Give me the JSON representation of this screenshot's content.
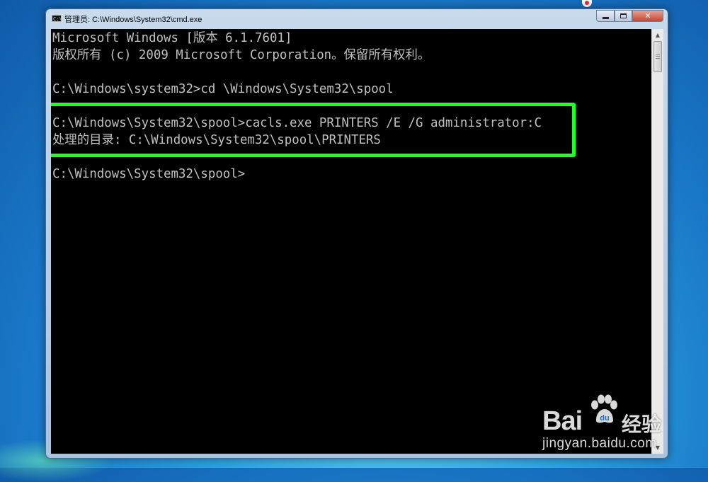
{
  "window": {
    "title": "管理员: C:\\Windows\\System32\\cmd.exe",
    "icon_name": "cmd-icon"
  },
  "console": {
    "lines": [
      "Microsoft Windows [版本 6.1.7601]",
      "版权所有 (c) 2009 Microsoft Corporation。保留所有权利。",
      "",
      "C:\\Windows\\system32>cd \\Windows\\System32\\spool",
      "",
      "C:\\Windows\\System32\\spool>cacls.exe PRINTERS /E /G administrator:C",
      "处理的目录: C:\\Windows\\System32\\spool\\PRINTERS",
      "",
      "C:\\Windows\\System32\\spool>"
    ],
    "text_color": "#c0c0c0",
    "background": "#000000",
    "highlight_color": "#22ff22"
  },
  "watermark": {
    "logo": "Bai",
    "logo_suffix": "经验",
    "url": "jingyan.baidu.com"
  }
}
